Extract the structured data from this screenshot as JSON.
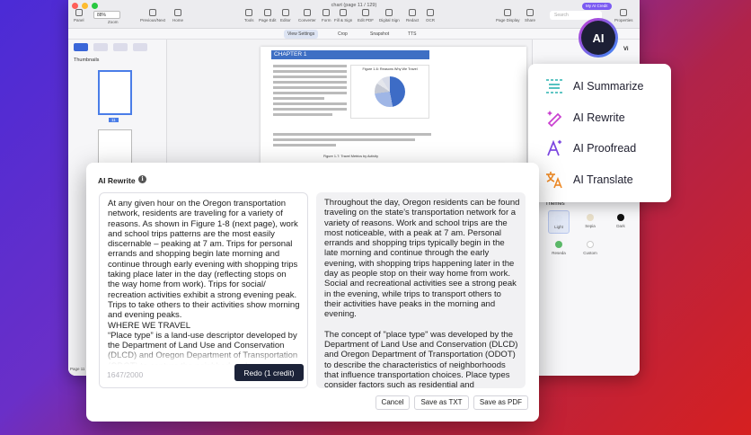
{
  "window": {
    "title": "chart (page 11 / 129)",
    "zoom": "88%",
    "search_placeholder": "Search",
    "credit_badge": "My AI Credit",
    "left_tools": [
      "Panel",
      "Zoom",
      "Previous/Next",
      "Home"
    ],
    "center_tools": [
      "Tools",
      "Page Edit",
      "Editor",
      "Converter",
      "Form",
      "Fill & Sign",
      "Edit PDF",
      "Digital Sign",
      "Redact",
      "OCR"
    ],
    "right_tools": [
      "Page Display",
      "Share",
      "Properties"
    ],
    "sub_tools": [
      "View Settings",
      "Crop",
      "Snapshot",
      "TTS"
    ]
  },
  "sidebar": {
    "heading": "Thumbnails",
    "selected_page": "11",
    "page_indicator": "Page 11"
  },
  "document": {
    "chapter": "CHAPTER 1",
    "figure_title": "Figure 1-6: Reasons Why We Travel",
    "figure_caption": "Figure 1-7: Travel Metrics by Activity"
  },
  "right_panel": {
    "themes_label": "Themes",
    "themes": [
      {
        "label": "Light",
        "color": "#dfe6f4"
      },
      {
        "label": "Sepia",
        "color": "#e8dfc9"
      },
      {
        "label": "Dark",
        "color": "#111111"
      },
      {
        "label": "Reseda",
        "color": "#5dbb6a"
      },
      {
        "label": "Custom",
        "color": "#ffffff"
      }
    ]
  },
  "ai_logo": {
    "text": "AI",
    "panel_label": "Vi"
  },
  "ai_menu": {
    "items": [
      {
        "label": "AI Summarize",
        "icon": "summarize-icon",
        "color": "#2bb3b1"
      },
      {
        "label": "AI Rewrite",
        "icon": "rewrite-icon",
        "color": "#c93fd0"
      },
      {
        "label": "AI Proofread",
        "icon": "proofread-icon",
        "color": "#7b46e0"
      },
      {
        "label": "AI Translate",
        "icon": "translate-icon",
        "color": "#f08a24"
      }
    ]
  },
  "dialog": {
    "title": "AI Rewrite",
    "original_text": "At any given hour on the Oregon transportation network, residents are traveling for a variety of reasons. As shown in Figure 1-8 (next page), work and school trips patterns are the most easily discernable – peaking at 7 am. Trips for personal errands and shopping begin late morning and continue through early evening with shopping trips taking place later in the day (reflecting stops on the way home from work). Trips for social/ recreation activities exhibit a strong evening peak. Trips to take others to their activities show morning and evening peaks.\nWHERE WE TRAVEL\n“Place type” is a land-use descriptor developed by the Department of Land Use and Conservation (DLCD) and Oregon Department of Transportation (ODOT) to capture the neighborhood characteristics that influence transportation",
    "char_count": "1647/2000",
    "redo_label": "Redo (1 credit)",
    "rewritten_text": "Throughout the day, Oregon residents can be found traveling on the state's transportation network for a variety of reasons. Work and school trips are the most noticeable, with a peak at 7 am. Personal errands and shopping trips typically begin in the late morning and continue through the early evening, with shopping trips happening later in the day as people stop on their way home from work. Social and recreational activities see a strong peak in the evening, while trips to transport others to their activities have peaks in the morning and evening.\n\nThe concept of \"place type\" was developed by the Department of Land Use and Conservation (DLCD) and Oregon Department of Transportation (ODOT) to describe the characteristics of neighborhoods that influence transportation choices. Place types consider factors such as residential and employment densities, as well as the availability of services and walkability, to determine",
    "cancel_label": "Cancel",
    "save_txt_label": "Save as TXT",
    "save_pdf_label": "Save as PDF"
  }
}
